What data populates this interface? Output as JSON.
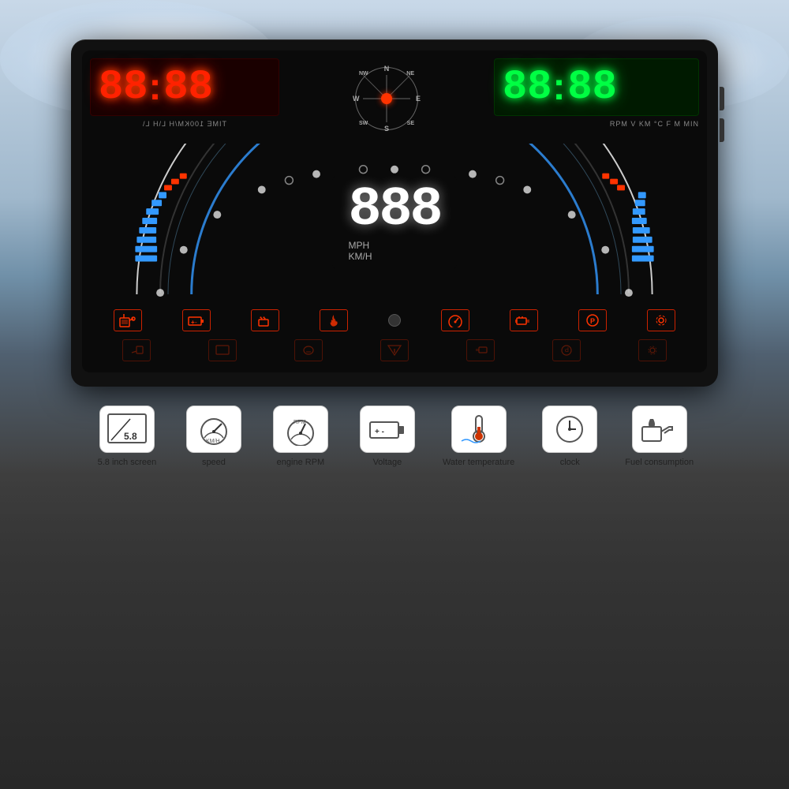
{
  "background": {
    "sky_color": "#a0b8cc",
    "road_color": "#303030"
  },
  "hud": {
    "red_display": {
      "value": "88:88",
      "labels": "TIME 100KM/H L\\H L\\"
    },
    "green_display": {
      "value": "88:88",
      "labels": "RPM V KM °C F M MIN"
    },
    "compass": {
      "directions": [
        "N",
        "NE",
        "E",
        "SE",
        "S",
        "SW",
        "W",
        "NW"
      ]
    },
    "speed_display": {
      "value": "888",
      "unit_line1": "MPH",
      "unit_line2": "KM/H"
    },
    "warning_icons": [
      {
        "symbol": "⛽",
        "label": "fuel"
      },
      {
        "symbol": "🔋",
        "label": "battery"
      },
      {
        "symbol": "☕",
        "label": "temp-warn"
      },
      {
        "symbol": "🔥",
        "label": "fire"
      },
      {
        "symbol": "⚙",
        "label": "settings-small"
      },
      {
        "symbol": "🔧",
        "label": "engine"
      },
      {
        "symbol": "🅿",
        "label": "parking"
      },
      {
        "symbol": "⚙",
        "label": "gear"
      }
    ]
  },
  "features": [
    {
      "id": "screen-size",
      "icon_type": "screen",
      "value": "5.8",
      "label": "5.8 inch screen"
    },
    {
      "id": "speed",
      "icon_type": "speedometer",
      "label": "speed"
    },
    {
      "id": "engine-rpm",
      "icon_type": "rpm-gauge",
      "label": "engine RPM"
    },
    {
      "id": "voltage",
      "icon_type": "battery",
      "label": "Voltage"
    },
    {
      "id": "water-temp",
      "icon_type": "thermometer",
      "label": "Water temperature"
    },
    {
      "id": "clock",
      "icon_type": "clock",
      "label": "clock"
    },
    {
      "id": "fuel-consumption",
      "icon_type": "oil-can",
      "label": "Fuel consumption"
    }
  ]
}
